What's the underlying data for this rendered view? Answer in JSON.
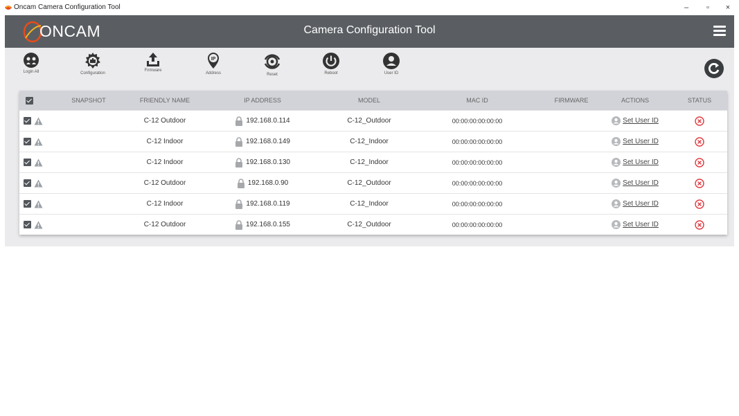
{
  "window": {
    "title": "Oncam Camera Configuration Tool",
    "controls": {
      "minimize": "–",
      "maximize": "▫",
      "close": "×"
    }
  },
  "header": {
    "logo_text": "ONCAM",
    "title": "Camera Configuration Tool"
  },
  "toolbar": {
    "items": [
      {
        "label": "Login All",
        "icon": "login-all-icon"
      },
      {
        "label": "Configuration",
        "icon": "configuration-icon"
      },
      {
        "label": "Firmware",
        "icon": "upload-icon"
      },
      {
        "label": "Address",
        "icon": "ip-pin-icon"
      },
      {
        "label": "Reset",
        "icon": "reset-icon"
      },
      {
        "label": "Reboot",
        "icon": "power-icon"
      },
      {
        "label": "User ID",
        "icon": "user-icon"
      }
    ],
    "refresh_icon": "refresh-icon"
  },
  "table": {
    "columns": [
      "SNAPSHOT",
      "FRIENDLY NAME",
      "IP ADDRESS",
      "MODEL",
      "MAC ID",
      "FIRMWARE",
      "ACTIONS",
      "STATUS"
    ],
    "rows": [
      {
        "friendly_name": "C-12 Outdoor",
        "ip": "192.168.0.114",
        "model": "C-12_Outdoor",
        "mac": "00:00:00:00:00:00",
        "firmware": "",
        "action": "Set User ID"
      },
      {
        "friendly_name": "C-12 Indoor",
        "ip": "192.168.0.149",
        "model": "C-12_Indoor",
        "mac": "00:00:00:00:00:00",
        "firmware": "",
        "action": "Set User ID"
      },
      {
        "friendly_name": "C-12 Indoor",
        "ip": "192.168.0.130",
        "model": "C-12_Indoor",
        "mac": "00:00:00:00:00:00",
        "firmware": "",
        "action": "Set User ID"
      },
      {
        "friendly_name": "C-12 Outdoor",
        "ip": "192.168.0.90",
        "model": "C-12_Outdoor",
        "mac": "00:00:00:00:00:00",
        "firmware": "",
        "action": "Set User ID"
      },
      {
        "friendly_name": "C-12 Indoor",
        "ip": "192.168.0.119",
        "model": "C-12_Indoor",
        "mac": "00:00:00:00:00:00",
        "firmware": "",
        "action": "Set User ID"
      },
      {
        "friendly_name": "C-12 Outdoor",
        "ip": "192.168.0.155",
        "model": "C-12_Outdoor",
        "mac": "00:00:00:00:00:00",
        "firmware": "",
        "action": "Set User ID"
      }
    ]
  },
  "colors": {
    "header_bg": "#5a5e63",
    "toolbar_bg": "#ebebed",
    "table_header_bg": "#d2d3d8",
    "status_error": "#e0393e",
    "warning_icon": "#9aa0a6"
  }
}
